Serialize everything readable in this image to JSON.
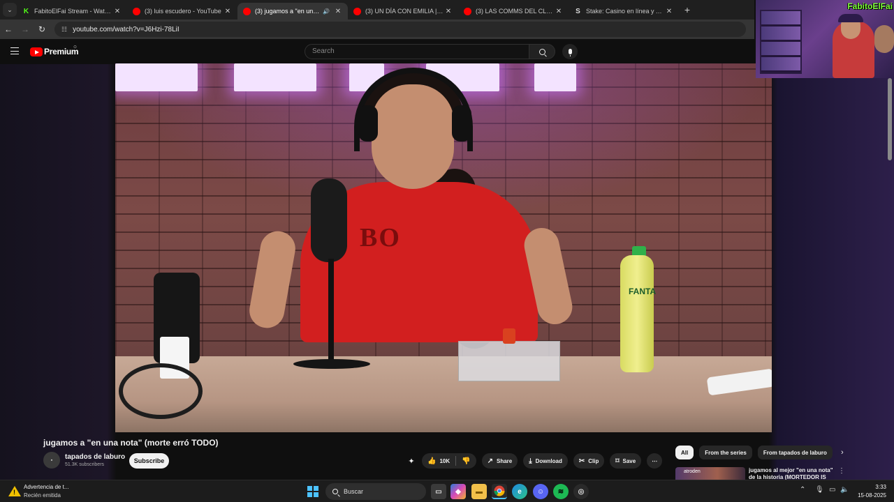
{
  "browser": {
    "tabs": [
      {
        "label": "FabitoElFai Stream - Watch Live",
        "favicon": "kick-icon",
        "active": false
      },
      {
        "label": "(3) luis escudero - YouTube",
        "favicon": "youtube-icon",
        "active": false
      },
      {
        "label": "(3) jugamos a \"en una nota",
        "favicon": "youtube-icon",
        "active": true,
        "audio": true
      },
      {
        "label": "(3) UN DÍA CON EMILIA | ESTAD",
        "favicon": "youtube-icon",
        "active": false
      },
      {
        "label": "(3) LAS COMMS DEL CLÁSICO",
        "favicon": "youtube-icon",
        "active": false
      },
      {
        "label": "Stake: Casino en línea y Apuest",
        "favicon": "stake-icon",
        "active": false
      }
    ],
    "url": "youtube.com/watch?v=J6Hzi-78LiI"
  },
  "youtube": {
    "brand": "Premium",
    "search_placeholder": "Search"
  },
  "webcam": {
    "streamer_name": "FabitoElFai"
  },
  "video": {
    "title": "jugamos a \"en una nota\" (morte erró TODO)",
    "shirt_text": "BO",
    "bottle_label": "FANTA",
    "channel": {
      "name": "tapados de laburo",
      "subscribers": "51.3K subscribers",
      "subscribe_label": "Subscribe"
    },
    "actions": {
      "likes": "10K",
      "share": "Share",
      "download": "Download",
      "clip": "Clip",
      "save": "Save"
    }
  },
  "sidebar": {
    "chips": [
      "All",
      "From the series",
      "From tapados de laburo"
    ],
    "recommendation": {
      "thumb_text": "atroden",
      "title": "jugamos al mejor \"en una nota\" de la historia (MORTEDOR IS"
    }
  },
  "taskbar": {
    "notification": {
      "title": "Advertencia de t...",
      "subtitle": "Recién emitida"
    },
    "search_label": "Buscar",
    "time": "3:33",
    "date": "15-08-2025"
  }
}
